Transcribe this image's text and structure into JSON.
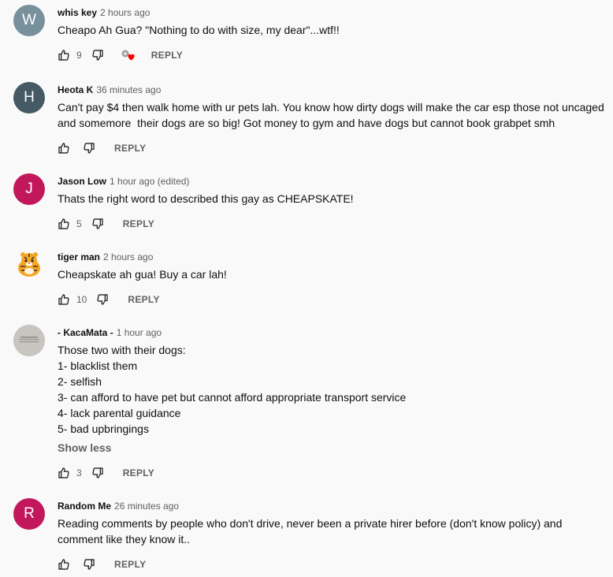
{
  "comments": [
    {
      "author": "whis key",
      "time": "2 hours ago",
      "avatar_letter": "W",
      "avatar_color": "#78909c",
      "lines": [
        "Cheapo Ah Gua? \"Nothing to do with size, my dear\"...wtf!!"
      ],
      "likes": "9",
      "reply_label": "REPLY",
      "has_creator_heart": true
    },
    {
      "author": "Heota K",
      "time": "36 minutes ago",
      "avatar_letter": "H",
      "avatar_color": "#455a64",
      "lines": [
        "Can't pay $4 then walk home with ur pets lah. You know how dirty dogs will make the car esp those not uncaged",
        "and somemore  their dogs are so big! Got money to gym and have dogs but cannot book grabpet smh"
      ],
      "likes": "",
      "reply_label": "REPLY"
    },
    {
      "author": "Jason Low",
      "time": "1 hour ago (edited)",
      "avatar_letter": "J",
      "avatar_color": "#c2185b",
      "lines": [
        "Thats the right word to described this gay as CHEAPSKATE!"
      ],
      "likes": "5",
      "reply_label": "REPLY"
    },
    {
      "author": "tiger man",
      "time": "2 hours ago",
      "avatar_letter": "",
      "avatar_color": "#f9f9f9",
      "lines": [
        "Cheapskate ah gua! Buy a car lah!"
      ],
      "likes": "10",
      "reply_label": "REPLY"
    },
    {
      "author": "- KacaMata -",
      "time": "1 hour ago",
      "avatar_letter": "",
      "avatar_color": "#bdbdbd",
      "lines": [
        "Those two with their dogs:",
        "1- blacklist them",
        "2- selfish",
        "3- can afford to have pet but cannot afford appropriate transport service",
        "4- lack parental guidance",
        "5- bad upbringings"
      ],
      "show_less": "Show less",
      "likes": "3",
      "reply_label": "REPLY"
    },
    {
      "author": "Random Me",
      "time": "26 minutes ago",
      "avatar_letter": "R",
      "avatar_color": "#c2185b",
      "lines": [
        "Reading comments by people who don't drive, never been a private hirer before (don't know policy) and",
        "comment like they know it.."
      ],
      "likes": "",
      "reply_label": "REPLY"
    }
  ],
  "colors": {
    "background": "#f9f9f9",
    "text": "#0f0f0f",
    "secondary": "#606060",
    "heart": "#ff0000"
  }
}
